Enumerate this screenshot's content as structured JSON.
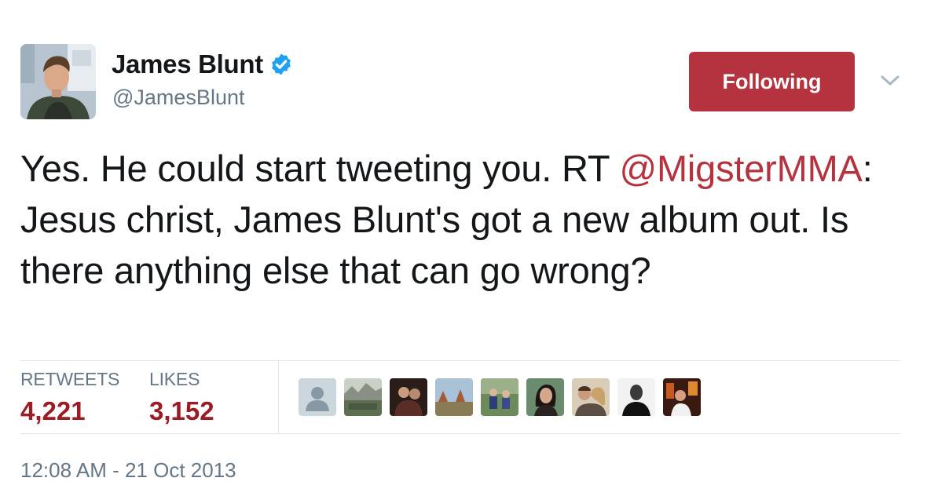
{
  "author": {
    "display_name": "James Blunt",
    "handle": "@JamesBlunt",
    "verified": true
  },
  "follow_button": {
    "label": "Following",
    "color": "#b5333e"
  },
  "tweet": {
    "text_before": "Yes. He could start tweeting you. RT ",
    "mention": "@MigsterMMA",
    "text_after": ": Jesus christ, James Blunt's got a new album out. Is there anything else that can go wrong?"
  },
  "stats": {
    "retweets_label": "RETWEETS",
    "retweets_count": "4,221",
    "likes_label": "LIKES",
    "likes_count": "3,152"
  },
  "likers": [
    {
      "icon": "default-avatar-icon"
    },
    {
      "icon": "landscape-photo-avatar"
    },
    {
      "icon": "people-photo-avatar"
    },
    {
      "icon": "desert-photo-avatar"
    },
    {
      "icon": "group-photo-avatar"
    },
    {
      "icon": "woman-photo-avatar"
    },
    {
      "icon": "couple-photo-avatar"
    },
    {
      "icon": "silhouette-portrait-avatar"
    },
    {
      "icon": "party-photo-avatar"
    }
  ],
  "timestamp": "12:08 AM - 21 Oct 2013",
  "colors": {
    "accent": "#b5333e",
    "stat_value": "#9b1c25",
    "verified": "#1da1f2",
    "muted": "#657786"
  }
}
